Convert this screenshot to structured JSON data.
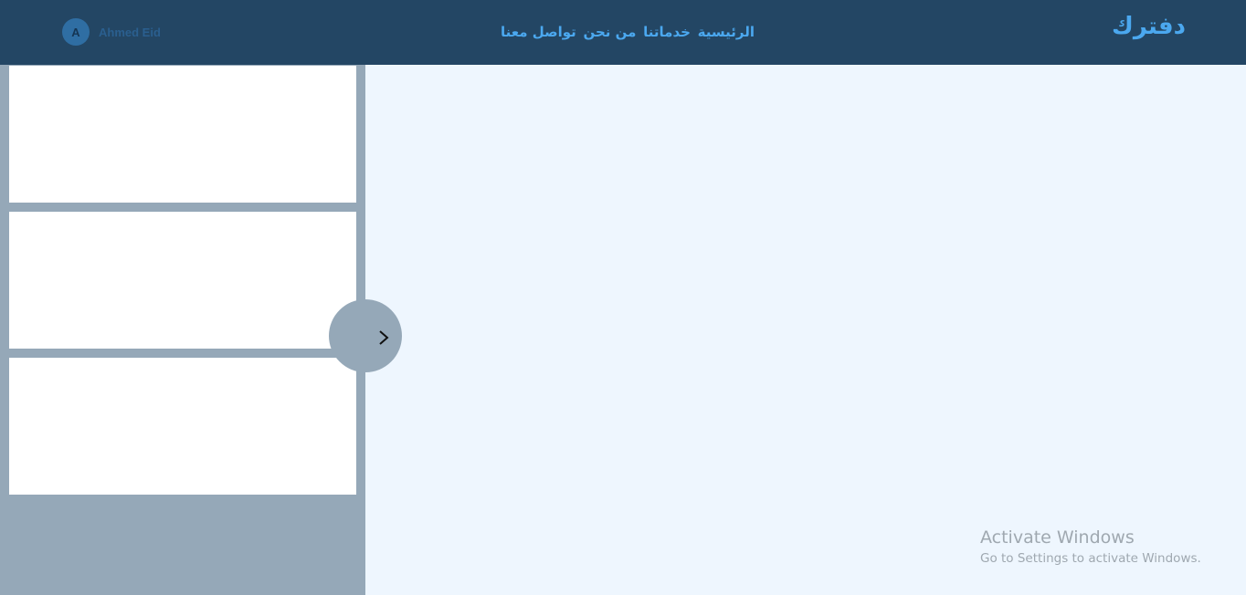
{
  "header": {
    "brand": "دفترك",
    "nav": [
      {
        "label": "الرئيسية"
      },
      {
        "label": "خدماتنا"
      },
      {
        "label": "من نحن"
      },
      {
        "label": "تواصل معنا"
      }
    ],
    "user": {
      "initial": "A",
      "name": "Ahmed Eid"
    }
  },
  "sidebar": {
    "toggle_icon": "chevron-right-icon",
    "cards": [
      {},
      {},
      {}
    ]
  },
  "watermark": {
    "title": "Activate Windows",
    "subtitle": "Go to Settings to activate Windows."
  },
  "colors": {
    "navbar": "#234664",
    "accent": "#4ba8ef",
    "sidebar": "#95a8b8",
    "content_bg": "#eef6fe"
  }
}
